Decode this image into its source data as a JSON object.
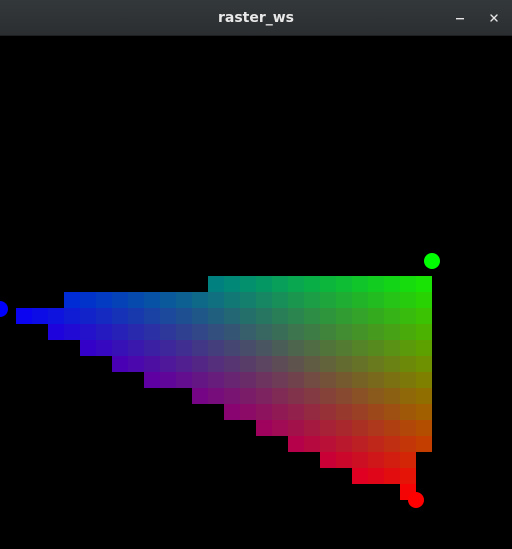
{
  "window": {
    "title": "raster_ws",
    "minimize_icon": "minimize-icon",
    "close_icon": "close-icon"
  },
  "scene": {
    "background": "#000000",
    "vertex_colors": {
      "blue": "#0000ff",
      "green": "#00ff00",
      "red": "#ff0000"
    }
  }
}
